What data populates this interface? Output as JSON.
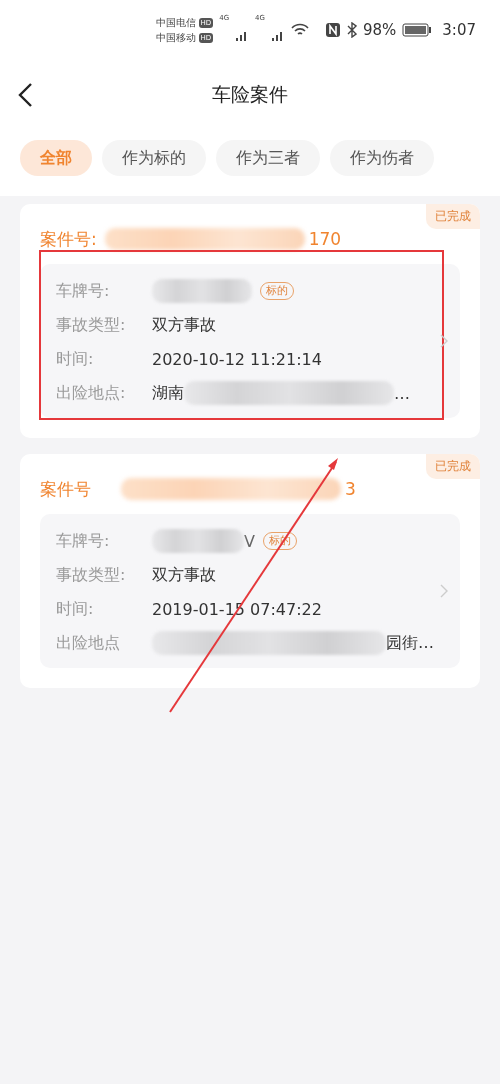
{
  "status_bar": {
    "carrier_1": "中国电信",
    "carrier_2": "中国移动",
    "hd_1": "HD",
    "hd_2": "HD",
    "net_1": "4G",
    "net_2": "4G",
    "battery": "98%",
    "time": "3:07"
  },
  "header": {
    "title": "车险案件"
  },
  "tabs": [
    {
      "label": "全部",
      "selected": true
    },
    {
      "label": "作为标的",
      "selected": false
    },
    {
      "label": "作为三者",
      "selected": false
    },
    {
      "label": "作为伤者",
      "selected": false
    }
  ],
  "cases": [
    {
      "status": "已完成",
      "case_label": "案件号:",
      "case_number_tail": "170",
      "plate_label": "车牌号:",
      "tag": "标的",
      "type_label": "事故类型:",
      "type_value": "双方事故",
      "time_label": "时间:",
      "time_value": "2020-10-12 11:21:14",
      "location_label": "出险地点:",
      "location_head": "湖南",
      "location_tail": "…",
      "highlighted": true
    },
    {
      "status": "已完成",
      "case_label": "案件号",
      "case_number_tail": "3",
      "plate_label": "车牌号:",
      "plate_tail": "V",
      "tag": "标的",
      "type_label": "事故类型:",
      "type_value": "双方事故",
      "time_label": "时间:",
      "time_value": "2019-01-15 07:47:22",
      "location_label": "出险地点",
      "location_tail": "园街…",
      "highlighted": false
    }
  ]
}
